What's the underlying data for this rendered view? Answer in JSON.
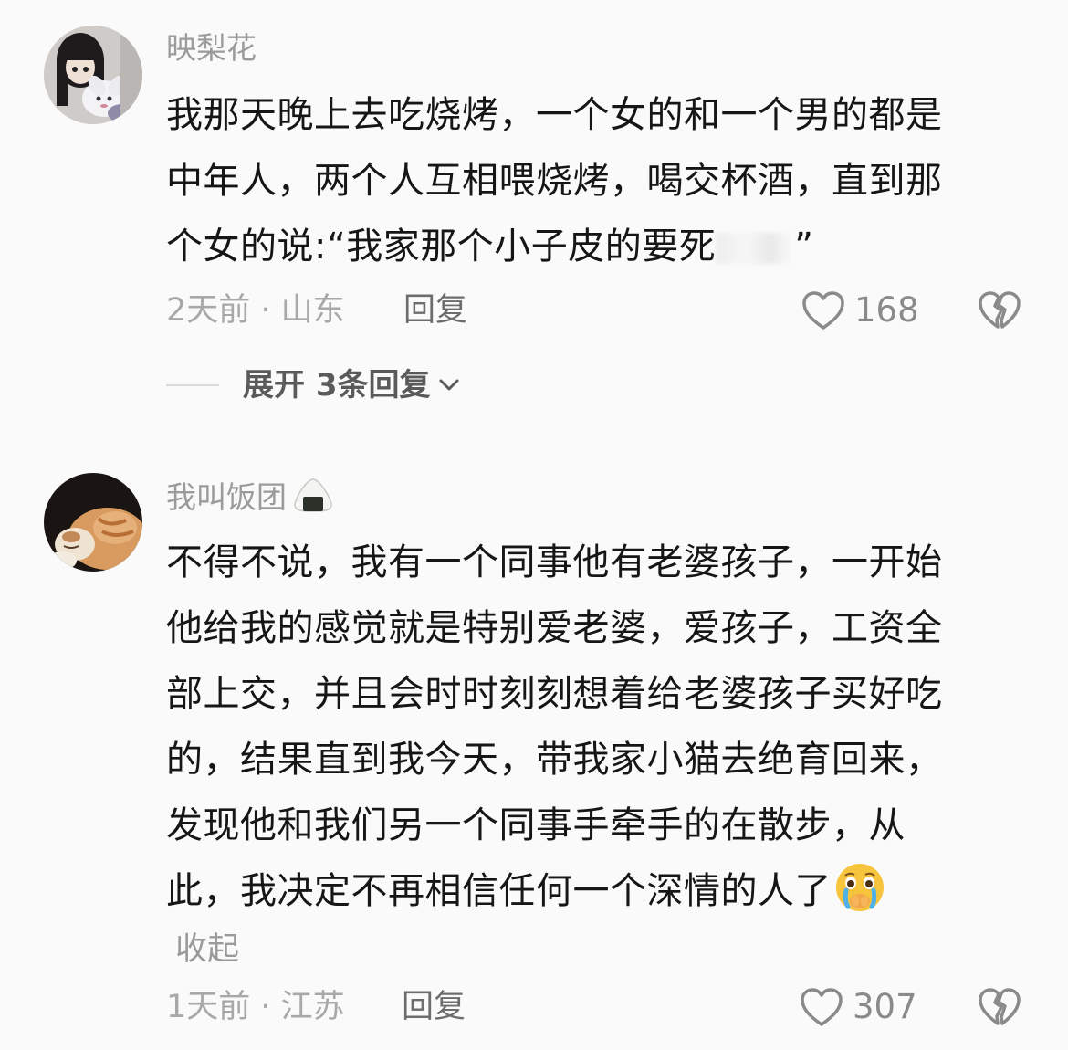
{
  "comments": [
    {
      "username": "映梨花",
      "avatar_icon": "anime-doll-avatar-icon",
      "lines": [
        "我那天晚上去吃烧烤，一个女的和一个男的都是",
        "中年人，两个人互相喂烧烤，喝交杯酒，直到那",
        "个女的说:“我家那个小子皮的要死"
      ],
      "line3_close_quote": "”",
      "time": "2天前",
      "separator": " · ",
      "location": "山东",
      "reply_label": "回复",
      "likes": "168",
      "expand_label": "展开 3条回复"
    },
    {
      "username": "我叫饭团",
      "username_icon": "onigiri-icon",
      "avatar_icon": "sleeping-cat-avatar-icon",
      "lines": [
        "不得不说，我有一个同事他有老婆孩子，一开始",
        "他给我的感觉就是特别爱老婆，爱孩子，工资全",
        "部上交，并且会时时刻刻想着给老婆孩子买好吃",
        "的，结果直到我今天，带我家小猫去绝育回来，",
        "发现他和我们另一个同事手牵手的在散步，从",
        "此，我决定不再相信任何一个深情的人了"
      ],
      "end_emoji": "crying-face-icon",
      "collapse_label": "收起",
      "time": "1天前",
      "separator": " · ",
      "location": "江苏",
      "reply_label": "回复",
      "likes": "307"
    }
  ],
  "colors": {
    "background": "#fafafa",
    "text": "#161616",
    "muted": "#a8a8a8",
    "username": "#9b9b9b"
  }
}
